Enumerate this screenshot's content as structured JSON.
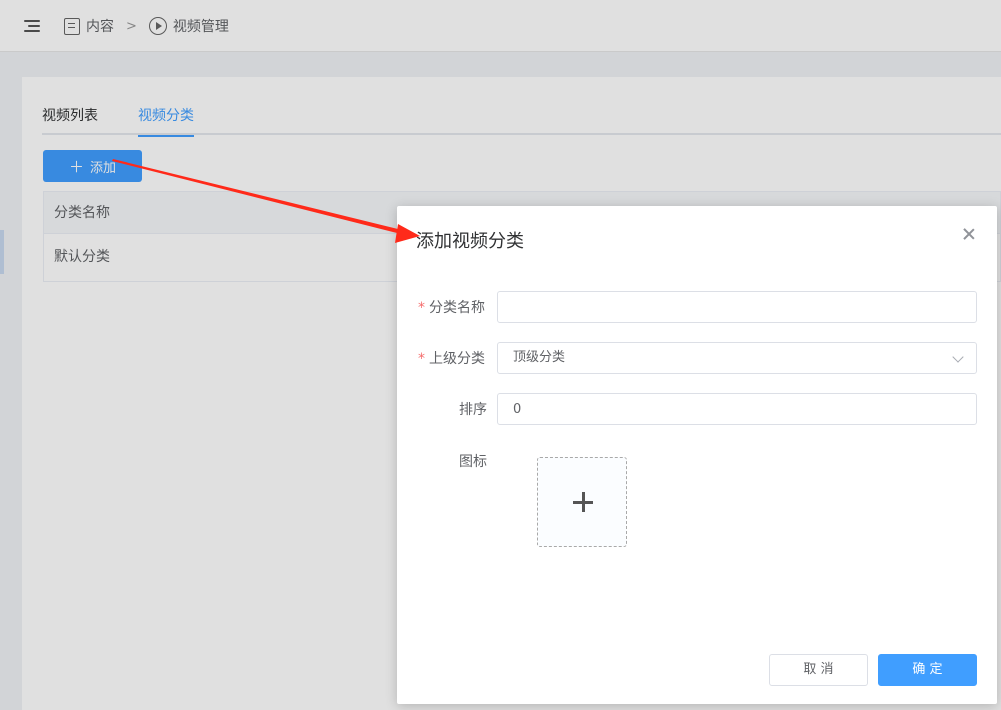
{
  "breadcrumb": {
    "root": "内容",
    "separator": ">",
    "current": "视频管理"
  },
  "tabs": [
    {
      "label": "视频列表"
    },
    {
      "label": "视频分类"
    }
  ],
  "toolbar": {
    "add_label": "添加"
  },
  "table": {
    "header": "分类名称",
    "rows": [
      {
        "name": "默认分类"
      }
    ]
  },
  "dialog": {
    "title": "添加视频分类",
    "fields": {
      "name": {
        "label": "分类名称",
        "required": "*",
        "value": ""
      },
      "parent": {
        "label": "上级分类",
        "required": "*",
        "value": "顶级分类"
      },
      "sort": {
        "label": "排序",
        "value": "0"
      },
      "icon": {
        "label": "图标"
      }
    },
    "cancel_label": "取 消",
    "confirm_label": "确 定"
  },
  "colors": {
    "primary": "#409eff",
    "required": "#f56c6c",
    "annotation": "#ff2a1a"
  }
}
